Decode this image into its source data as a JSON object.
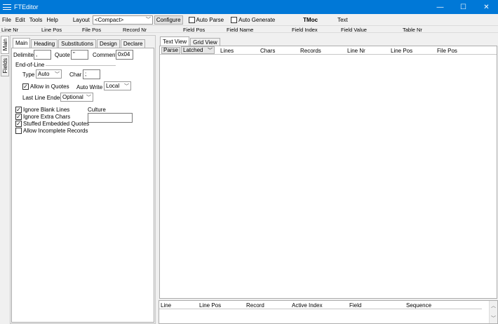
{
  "window": {
    "title": "FTEditor",
    "controls": {
      "minimize": "—",
      "maximize": "☐",
      "close": "✕"
    }
  },
  "menu": {
    "items": [
      "File",
      "Edit",
      "Tools",
      "Help"
    ],
    "layout_label": "Layout",
    "layout_value": "<Compact>",
    "configure_label": "Configure",
    "auto_parse_label": "Auto Parse",
    "auto_generate_label": "Auto Generate",
    "tmoc_label": "TMoc",
    "text_label": "Text"
  },
  "status_headers": [
    "Line Nr",
    "Line Pos",
    "File Pos",
    "Record Nr",
    "Field Pos",
    "Field Name",
    "Field Index",
    "Field Value",
    "Table Nr"
  ],
  "side_tabs": [
    "Main",
    "Fields"
  ],
  "left_tabs": [
    "Main",
    "Heading",
    "Substitutions",
    "Design",
    "Declare"
  ],
  "main_tab": {
    "delimiter_label": "Delimiter",
    "delimiter_value": ",",
    "quote_label": "Quote",
    "quote_value": "\"",
    "comment_label": "Comment",
    "comment_value": "0x04",
    "eol_label": "End-of-Line",
    "type_label": "Type",
    "type_value": "Auto",
    "char_label": "Char",
    "char_value": ";",
    "allow_in_quotes_label": "Allow in Quotes",
    "auto_write_label": "Auto Write",
    "auto_write_value": "Local",
    "last_line_ended_label": "Last Line Ended",
    "last_line_ended_value": "Optional",
    "ignore_blank_lines_label": "Ignore Blank Lines",
    "ignore_extra_chars_label": "Ignore Extra Chars",
    "stuffed_quotes_label": "Stuffed Embedded Quotes",
    "allow_incomplete_label": "Allow Incomplete Records",
    "culture_label": "Culture",
    "culture_value": ""
  },
  "right_tabs": [
    "Text View",
    "Grid View"
  ],
  "text_view": {
    "parse_label": "Parse",
    "latched_value": "Latched",
    "columns": [
      "Lines",
      "Chars",
      "Records",
      "Line Nr",
      "Line Pos",
      "File Pos"
    ]
  },
  "bottom_columns": [
    "Line",
    "Line Pos",
    "Record",
    "Active Index",
    "Field",
    "Sequence"
  ]
}
